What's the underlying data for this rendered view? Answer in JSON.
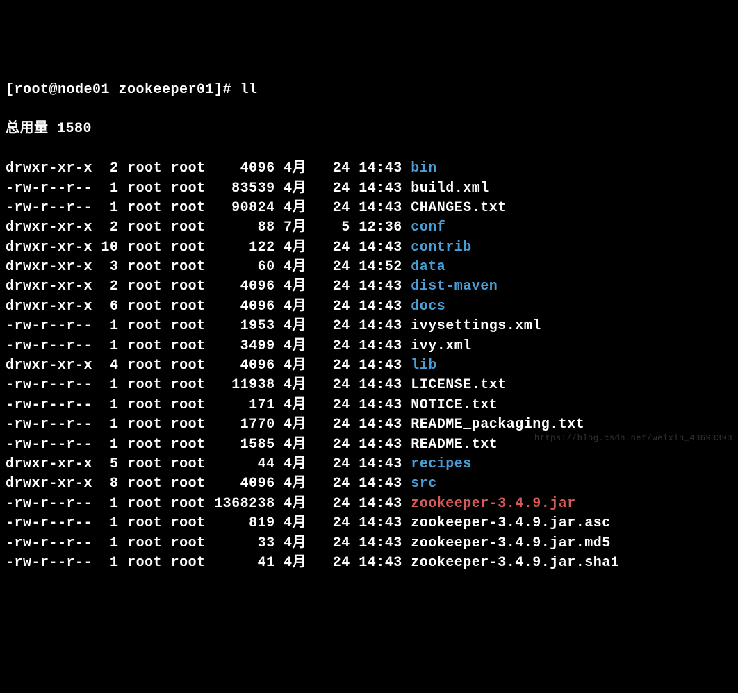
{
  "prompt": "[root@node01 zookeeper01]# ll",
  "total_label": "总用量 1580",
  "files": [
    {
      "perms": "drwxr-xr-x",
      "links": "2",
      "owner": "root",
      "group": "root",
      "size": "4096",
      "month": "4月",
      "day": "24",
      "time": "14:43",
      "name": "bin",
      "type": "dir"
    },
    {
      "perms": "-rw-r--r--",
      "links": "1",
      "owner": "root",
      "group": "root",
      "size": "83539",
      "month": "4月",
      "day": "24",
      "time": "14:43",
      "name": "build.xml",
      "type": "file"
    },
    {
      "perms": "-rw-r--r--",
      "links": "1",
      "owner": "root",
      "group": "root",
      "size": "90824",
      "month": "4月",
      "day": "24",
      "time": "14:43",
      "name": "CHANGES.txt",
      "type": "file"
    },
    {
      "perms": "drwxr-xr-x",
      "links": "2",
      "owner": "root",
      "group": "root",
      "size": "88",
      "month": "7月",
      "day": "5",
      "time": "12:36",
      "name": "conf",
      "type": "dir"
    },
    {
      "perms": "drwxr-xr-x",
      "links": "10",
      "owner": "root",
      "group": "root",
      "size": "122",
      "month": "4月",
      "day": "24",
      "time": "14:43",
      "name": "contrib",
      "type": "dir"
    },
    {
      "perms": "drwxr-xr-x",
      "links": "3",
      "owner": "root",
      "group": "root",
      "size": "60",
      "month": "4月",
      "day": "24",
      "time": "14:52",
      "name": "data",
      "type": "dir"
    },
    {
      "perms": "drwxr-xr-x",
      "links": "2",
      "owner": "root",
      "group": "root",
      "size": "4096",
      "month": "4月",
      "day": "24",
      "time": "14:43",
      "name": "dist-maven",
      "type": "dir"
    },
    {
      "perms": "drwxr-xr-x",
      "links": "6",
      "owner": "root",
      "group": "root",
      "size": "4096",
      "month": "4月",
      "day": "24",
      "time": "14:43",
      "name": "docs",
      "type": "dir"
    },
    {
      "perms": "-rw-r--r--",
      "links": "1",
      "owner": "root",
      "group": "root",
      "size": "1953",
      "month": "4月",
      "day": "24",
      "time": "14:43",
      "name": "ivysettings.xml",
      "type": "file"
    },
    {
      "perms": "-rw-r--r--",
      "links": "1",
      "owner": "root",
      "group": "root",
      "size": "3499",
      "month": "4月",
      "day": "24",
      "time": "14:43",
      "name": "ivy.xml",
      "type": "file"
    },
    {
      "perms": "drwxr-xr-x",
      "links": "4",
      "owner": "root",
      "group": "root",
      "size": "4096",
      "month": "4月",
      "day": "24",
      "time": "14:43",
      "name": "lib",
      "type": "dir"
    },
    {
      "perms": "-rw-r--r--",
      "links": "1",
      "owner": "root",
      "group": "root",
      "size": "11938",
      "month": "4月",
      "day": "24",
      "time": "14:43",
      "name": "LICENSE.txt",
      "type": "file"
    },
    {
      "perms": "-rw-r--r--",
      "links": "1",
      "owner": "root",
      "group": "root",
      "size": "171",
      "month": "4月",
      "day": "24",
      "time": "14:43",
      "name": "NOTICE.txt",
      "type": "file"
    },
    {
      "perms": "-rw-r--r--",
      "links": "1",
      "owner": "root",
      "group": "root",
      "size": "1770",
      "month": "4月",
      "day": "24",
      "time": "14:43",
      "name": "README_packaging.txt",
      "type": "file"
    },
    {
      "perms": "-rw-r--r--",
      "links": "1",
      "owner": "root",
      "group": "root",
      "size": "1585",
      "month": "4月",
      "day": "24",
      "time": "14:43",
      "name": "README.txt",
      "type": "file"
    },
    {
      "perms": "drwxr-xr-x",
      "links": "5",
      "owner": "root",
      "group": "root",
      "size": "44",
      "month": "4月",
      "day": "24",
      "time": "14:43",
      "name": "recipes",
      "type": "dir"
    },
    {
      "perms": "drwxr-xr-x",
      "links": "8",
      "owner": "root",
      "group": "root",
      "size": "4096",
      "month": "4月",
      "day": "24",
      "time": "14:43",
      "name": "src",
      "type": "dir"
    },
    {
      "perms": "-rw-r--r--",
      "links": "1",
      "owner": "root",
      "group": "root",
      "size": "1368238",
      "month": "4月",
      "day": "24",
      "time": "14:43",
      "name": "zookeeper-3.4.9.jar",
      "type": "exec"
    },
    {
      "perms": "-rw-r--r--",
      "links": "1",
      "owner": "root",
      "group": "root",
      "size": "819",
      "month": "4月",
      "day": "24",
      "time": "14:43",
      "name": "zookeeper-3.4.9.jar.asc",
      "type": "file"
    },
    {
      "perms": "-rw-r--r--",
      "links": "1",
      "owner": "root",
      "group": "root",
      "size": "33",
      "month": "4月",
      "day": "24",
      "time": "14:43",
      "name": "zookeeper-3.4.9.jar.md5",
      "type": "file"
    },
    {
      "perms": "-rw-r--r--",
      "links": "1",
      "owner": "root",
      "group": "root",
      "size": "41",
      "month": "4月",
      "day": "24",
      "time": "14:43",
      "name": "zookeeper-3.4.9.jar.sha1",
      "type": "file"
    }
  ],
  "watermark": "https://blog.csdn.net/weixin_43693393"
}
